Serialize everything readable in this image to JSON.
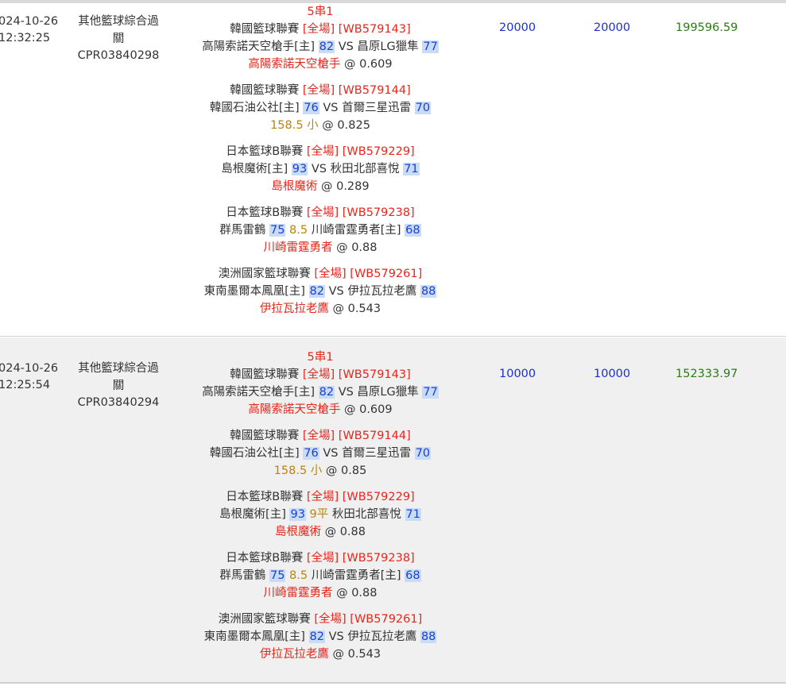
{
  "rows": [
    {
      "date": "024-10-26",
      "time": "12:32:25",
      "type_line1": "其他籃球綜合過",
      "type_line2": "關",
      "order_id": "CPR03840298",
      "combo": "5串1",
      "legs": [
        {
          "league": "韓國籃球聯賽",
          "period": "[全場]",
          "code": "[WB579143]",
          "home": "高陽索諾天空槍手[主]",
          "home_score": "82",
          "mid": "VS",
          "away": "昌原LG獵隼",
          "away_score": "77",
          "pick": "高陽索諾天空槍手",
          "at": "@",
          "odds": "0.609"
        },
        {
          "league": "韓國籃球聯賽",
          "period": "[全場]",
          "code": "[WB579144]",
          "home": "韓國石油公社[主]",
          "home_score": "76",
          "mid": "VS",
          "away": "首爾三星迅雷",
          "away_score": "70",
          "pick": "158.5 小",
          "at": "@",
          "odds": "0.825"
        },
        {
          "league": "日本籃球B聯賽",
          "period": "[全場]",
          "code": "[WB579229]",
          "home": "島根魔術[主]",
          "home_score": "93",
          "mid": "VS",
          "away": "秋田北部喜悅",
          "away_score": "71",
          "pick": "島根魔術",
          "at": "@",
          "odds": "0.289"
        },
        {
          "league": "日本籃球B聯賽",
          "period": "[全場]",
          "code": "[WB579238]",
          "home": "群馬雷鶴",
          "home_score": "75",
          "mid": "8.5",
          "away": "川崎雷霆勇者[主]",
          "away_score": "68",
          "pick": "川崎雷霆勇者",
          "at": "@",
          "odds": "0.88"
        },
        {
          "league": "澳洲國家籃球聯賽",
          "period": "[全場]",
          "code": "[WB579261]",
          "home": "東南墨爾本鳳凰[主]",
          "home_score": "82",
          "mid": "VS",
          "away": "伊拉瓦拉老鷹",
          "away_score": "88",
          "pick": "伊拉瓦拉老鷹",
          "at": "@",
          "odds": "0.543"
        }
      ],
      "stake": "20000",
      "valid": "20000",
      "win": "199596.59"
    },
    {
      "date": "024-10-26",
      "time": "12:25:54",
      "type_line1": "其他籃球綜合過",
      "type_line2": "關",
      "order_id": "CPR03840294",
      "combo": "5串1",
      "legs": [
        {
          "league": "韓國籃球聯賽",
          "period": "[全場]",
          "code": "[WB579143]",
          "home": "高陽索諾天空槍手[主]",
          "home_score": "82",
          "mid": "VS",
          "away": "昌原LG獵隼",
          "away_score": "77",
          "pick": "高陽索諾天空槍手",
          "at": "@",
          "odds": "0.609"
        },
        {
          "league": "韓國籃球聯賽",
          "period": "[全場]",
          "code": "[WB579144]",
          "home": "韓國石油公社[主]",
          "home_score": "76",
          "mid": "VS",
          "away": "首爾三星迅雷",
          "away_score": "70",
          "pick": "158.5 小",
          "at": "@",
          "odds": "0.85"
        },
        {
          "league": "日本籃球B聯賽",
          "period": "[全場]",
          "code": "[WB579229]",
          "home": "島根魔術[主]",
          "home_score": "93",
          "mid": "9平",
          "away": "秋田北部喜悅",
          "away_score": "71",
          "pick": "島根魔術",
          "at": "@",
          "odds": "0.88"
        },
        {
          "league": "日本籃球B聯賽",
          "period": "[全場]",
          "code": "[WB579238]",
          "home": "群馬雷鶴",
          "home_score": "75",
          "mid": "8.5",
          "away": "川崎雷霆勇者[主]",
          "away_score": "68",
          "pick": "川崎雷霆勇者",
          "at": "@",
          "odds": "0.88"
        },
        {
          "league": "澳洲國家籃球聯賽",
          "period": "[全場]",
          "code": "[WB579261]",
          "home": "東南墨爾本鳳凰[主]",
          "home_score": "82",
          "mid": "VS",
          "away": "伊拉瓦拉老鷹",
          "away_score": "88",
          "pick": "伊拉瓦拉老鷹",
          "at": "@",
          "odds": "0.543"
        }
      ],
      "stake": "10000",
      "valid": "10000",
      "win": "152333.97"
    }
  ]
}
